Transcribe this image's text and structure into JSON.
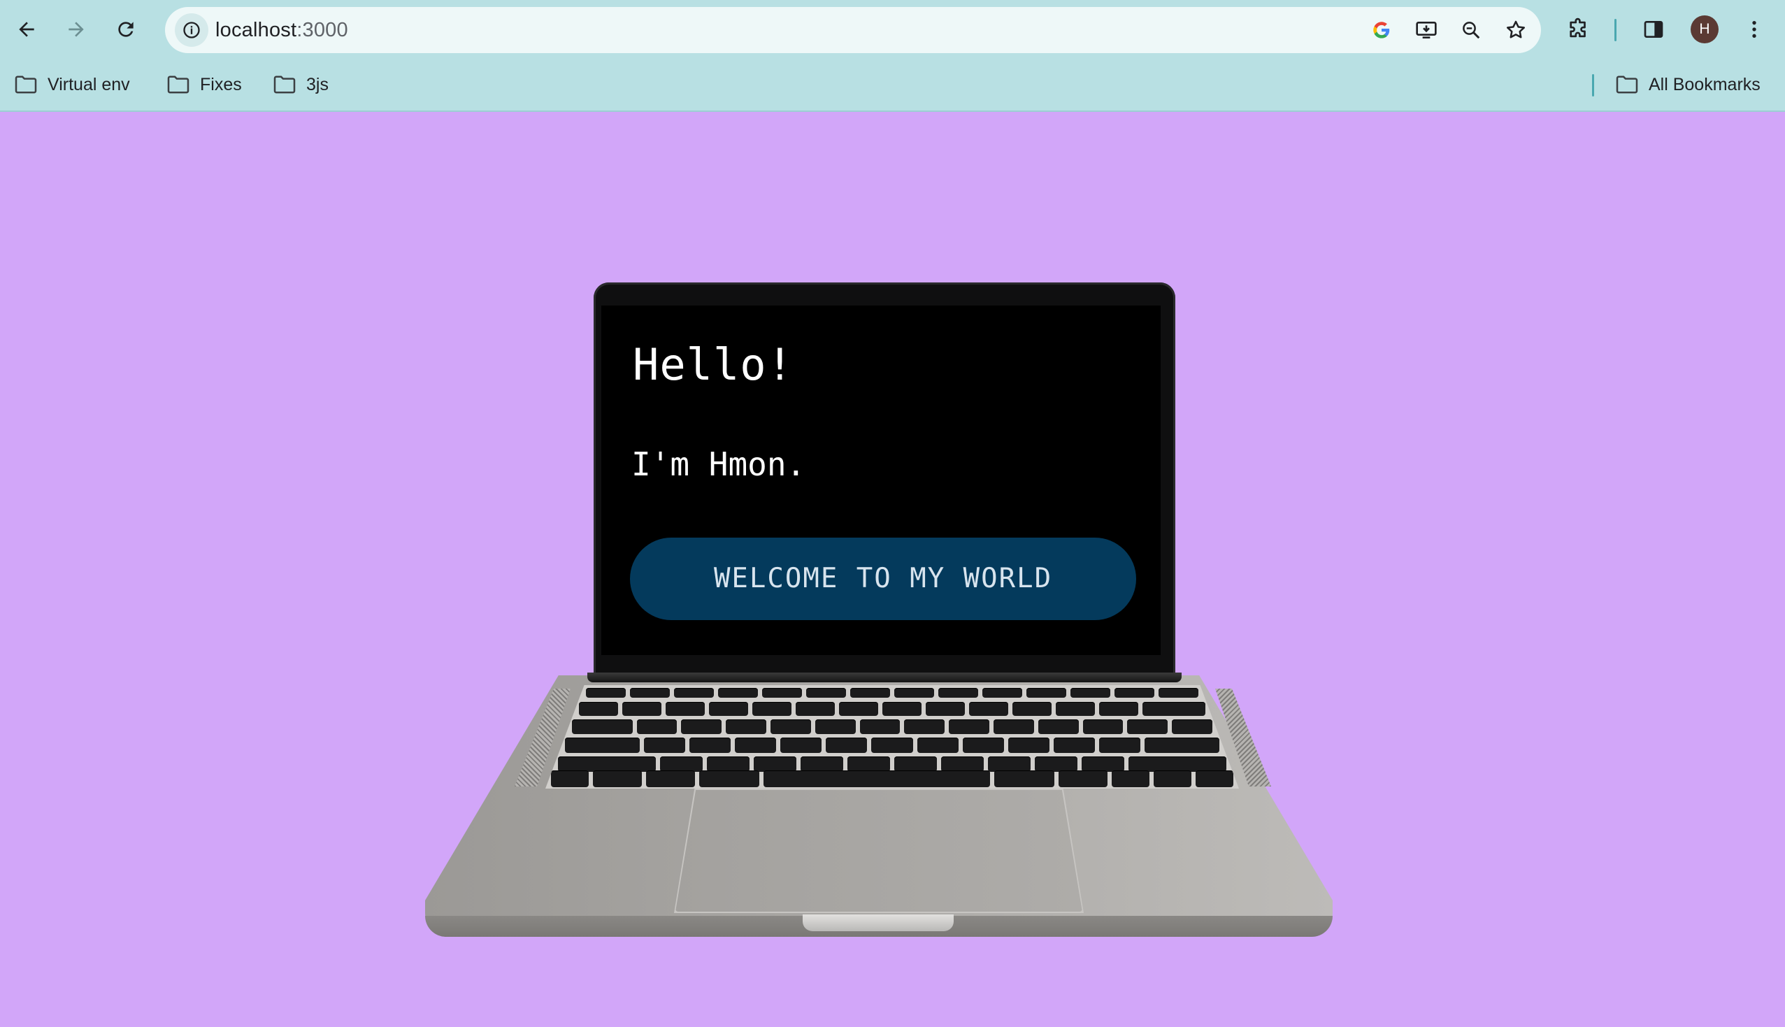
{
  "browser": {
    "url_host": "localhost",
    "url_port": ":3000",
    "profile_initial": "H",
    "bookmarks": [
      {
        "label": "Virtual env",
        "icon": "folder-icon"
      },
      {
        "label": "Fixes",
        "icon": "folder-icon"
      },
      {
        "label": "3js",
        "icon": "folder-icon"
      }
    ],
    "all_bookmarks_label": "All Bookmarks"
  },
  "page": {
    "greeting": "Hello!",
    "intro": "I'm Hmon.",
    "welcome_button": "WELCOME TO MY WORLD",
    "background_color": "#d2a6f9",
    "button_color": "#043a5c"
  }
}
